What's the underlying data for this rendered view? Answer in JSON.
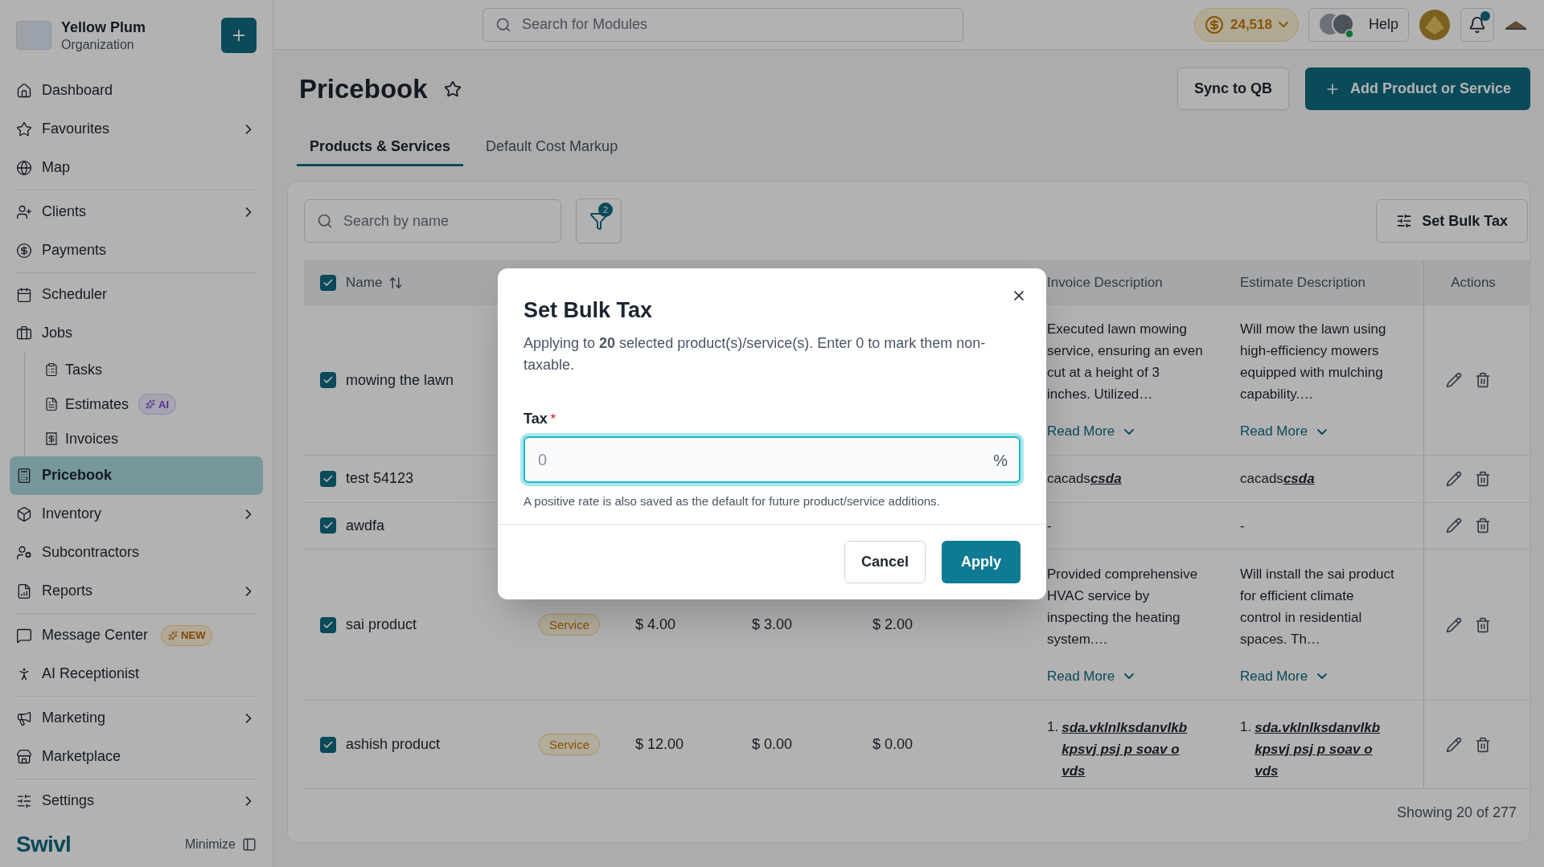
{
  "org": {
    "name": "Yellow Plum",
    "subtitle": "Organization"
  },
  "sidebar": {
    "groups": [
      [
        {
          "label": "Dashboard",
          "selected": false,
          "expandable": false
        },
        {
          "label": "Favourites",
          "selected": false,
          "expandable": true
        },
        {
          "label": "Map",
          "selected": false,
          "expandable": false
        }
      ],
      [
        {
          "label": "Clients",
          "selected": false,
          "expandable": true
        },
        {
          "label": "Payments",
          "selected": false,
          "expandable": false
        }
      ],
      [
        {
          "label": "Scheduler",
          "selected": false,
          "expandable": false
        },
        {
          "label": "Jobs",
          "selected": false,
          "expandable": false,
          "children": [
            {
              "label": "Tasks",
              "selected": false
            },
            {
              "label": "Estimates",
              "selected": false,
              "badge": {
                "kind": "ai",
                "text": "AI"
              }
            },
            {
              "label": "Invoices",
              "selected": false
            }
          ]
        },
        {
          "label": "Pricebook",
          "selected": true,
          "expandable": false
        },
        {
          "label": "Inventory",
          "selected": false,
          "expandable": true
        },
        {
          "label": "Subcontractors",
          "selected": false,
          "expandable": false
        },
        {
          "label": "Reports",
          "selected": false,
          "expandable": true
        }
      ],
      [
        {
          "label": "Message Center",
          "selected": false,
          "expandable": false,
          "badge": {
            "kind": "new",
            "text": "NEW"
          }
        },
        {
          "label": "AI Receptionist",
          "selected": false,
          "expandable": false
        }
      ],
      [
        {
          "label": "Marketing",
          "selected": false,
          "expandable": true
        },
        {
          "label": "Marketplace",
          "selected": false,
          "expandable": false
        }
      ],
      [
        {
          "label": "Settings",
          "selected": false,
          "expandable": true
        }
      ]
    ],
    "logo": "Swivl",
    "minimize": "Minimize"
  },
  "topbar": {
    "search_placeholder": "Search for Modules",
    "coins": "24,518",
    "help": "Help"
  },
  "page": {
    "title": "Pricebook",
    "buttons": [
      "Sync to QB",
      "Add Product or Service"
    ],
    "tabs": [
      {
        "label": "Products & Services",
        "selected": true
      },
      {
        "label": "Default Cost Markup",
        "selected": false
      }
    ]
  },
  "toolbar": {
    "search_placeholder": "Search by name",
    "filter_count": "2",
    "bulk_button": "Set Bulk Tax"
  },
  "table": {
    "all_checked": true,
    "columns": [
      {
        "label": "Name",
        "sortable": true
      },
      {
        "label": "Invoice Description",
        "sortable": false
      },
      {
        "label": "Estimate Description",
        "sortable": false
      },
      {
        "label": "Actions",
        "sortable": false
      }
    ],
    "rows": [
      {
        "name": "mowing the lawn",
        "checked": true,
        "invoice": {
          "kind": "text",
          "text": "Executed lawn mowing service, ensuring an even cut at a height of 3 inches. Utilized…",
          "read_more": "Read More"
        },
        "estimate": {
          "kind": "text",
          "text": "Will mow the lawn using high-efficiency mowers equipped with mulching capability.…",
          "read_more": "Read More"
        }
      },
      {
        "name": "test 54123",
        "checked": true,
        "invoice": {
          "kind": "link",
          "text": "cacads",
          "link": "csda"
        },
        "estimate": {
          "kind": "link",
          "text": "cacads",
          "link": "csda"
        }
      },
      {
        "name": "awdfa",
        "checked": true,
        "invoice": {
          "kind": "dash",
          "text": "-"
        },
        "estimate": {
          "kind": "dash",
          "text": "-"
        }
      },
      {
        "name": "sai product",
        "checked": true,
        "type": "Service",
        "prices": [
          "$ 4.00",
          "$ 3.00",
          "$ 2.00"
        ],
        "invoice": {
          "kind": "text",
          "text": "Provided comprehensive HVAC service by inspecting the heating system.…",
          "read_more": "Read More"
        },
        "estimate": {
          "kind": "text",
          "text": "Will install the sai product for efficient climate control in residential spaces. Th…",
          "read_more": "Read More"
        }
      },
      {
        "name": "ashish product",
        "checked": true,
        "type": "Service",
        "prices": [
          "$ 12.00",
          "$ 0.00",
          "$ 0.00"
        ],
        "invoice": {
          "kind": "list",
          "items": [
            {
              "number": "1.",
              "text": "sda.vklnlksdanvlkb kpsvj psj p soav o vds"
            }
          ]
        },
        "estimate": {
          "kind": "list",
          "items": [
            {
              "number": "1.",
              "text": "sda.vklnlksdanvlkb kpsvj psj p soav o vds"
            }
          ]
        }
      }
    ],
    "footer": "Showing 20 of 277"
  },
  "modal": {
    "title": "Set Bulk Tax",
    "description": "Applying to **20** selected product(s)/service(s). Enter 0 to mark them non-taxable.",
    "field_label": "Tax",
    "required_mark": "*",
    "placeholder": "0",
    "suffix": "%",
    "focused": true,
    "help": "A positive rate is also saved as the default for future product/service additions.",
    "buttons": [
      "Cancel",
      "Apply"
    ]
  }
}
